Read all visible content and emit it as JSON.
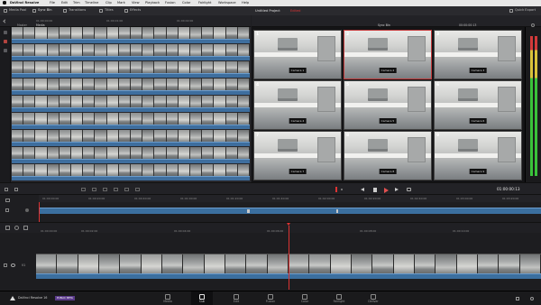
{
  "menubar": {
    "app_name": "DaVinci Resolve",
    "items": [
      "File",
      "Edit",
      "Trim",
      "Timeline",
      "Clip",
      "Mark",
      "View",
      "Playback",
      "Fusion",
      "Color",
      "Fairlight",
      "Workspace",
      "Help"
    ],
    "window_title": "Untitled Project"
  },
  "toolbar": {
    "media_pool": "Media Pool",
    "sync_bin": "Sync Bin",
    "transitions": "Transitions",
    "titles": "Titles",
    "effects": "Effects",
    "project_title": "Untitled Project",
    "project_status": "Edited",
    "quick_export": "Quick Export"
  },
  "browser": {
    "crumb_master": "Master",
    "crumb_media": "Media",
    "timecodes": [
      "01:00:00:00",
      "01:00:01:00",
      "01:00:02:00"
    ]
  },
  "viewer": {
    "title": "Sync Bin",
    "timecode_top": "00:00:00:13",
    "cameras": [
      {
        "num": "1",
        "label": "Camera 1"
      },
      {
        "num": "2",
        "label": "Camera 2"
      },
      {
        "num": "3",
        "label": "Camera 3"
      },
      {
        "num": "4",
        "label": "Camera 4"
      },
      {
        "num": "5",
        "label": "Camera 5"
      },
      {
        "num": "6",
        "label": "Camera 6"
      },
      {
        "num": "7",
        "label": "Camera 7"
      },
      {
        "num": "8",
        "label": "Camera 8"
      },
      {
        "num": "9",
        "label": "Camera 9"
      }
    ],
    "selected_camera": 2
  },
  "transport": {
    "timecode": "01:00:00:13"
  },
  "timeline_upper": {
    "ticks": [
      "01:00:00:00",
      "01:00:20:00",
      "01:00:40:00",
      "01:01:00:00",
      "01:01:20:00",
      "01:01:40:00",
      "01:02:00:00",
      "01:02:20:00",
      "01:02:40:00",
      "01:03:00:00",
      "01:03:20:00"
    ]
  },
  "timeline_lower": {
    "ticks": [
      "01:00:00:00",
      "01:00:02:00",
      "01:00:04:00",
      "01:00:06:00",
      "01:00:08:00",
      "01:00:10:00",
      "01:00:12:00"
    ],
    "track_label": "V1"
  },
  "pagebar": {
    "product": "DaVinci Resolve 16",
    "badge": "PUBLIC BETA",
    "pages": [
      {
        "key": "media",
        "label": "Media"
      },
      {
        "key": "cut",
        "label": "Cut"
      },
      {
        "key": "edit",
        "label": "Edit"
      },
      {
        "key": "fusion",
        "label": "Fusion"
      },
      {
        "key": "color",
        "label": "Color"
      },
      {
        "key": "fairlight",
        "label": "Fairlight"
      },
      {
        "key": "deliver",
        "label": "Deliver"
      }
    ],
    "active_page": "cut"
  },
  "colors": {
    "accent_red": "#d33333",
    "audio_blue": "#3b6f9f",
    "meter_green": "#3ac23a"
  }
}
